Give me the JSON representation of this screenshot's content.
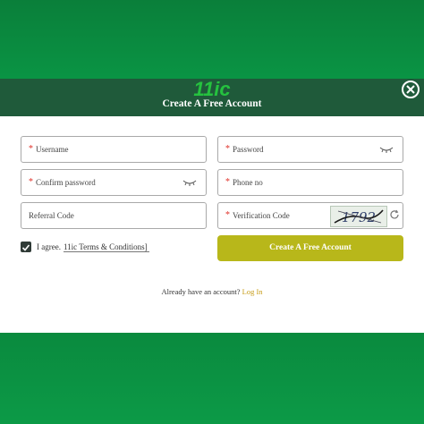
{
  "modal": {
    "logo_text": "11ic",
    "title": "Create A Free Account"
  },
  "form": {
    "username_label": "Username",
    "password_label": "Password",
    "confirm_password_label": "Confirm password",
    "phone_label": "Phone no",
    "referral_label": "Referral Code",
    "verification_label": "Verification Code",
    "captcha_text": "1792",
    "required_mark": "*",
    "agree_prefix": "I agree.",
    "terms_link": "11ic Terms & Conditions]",
    "submit_label": "Create A Free Account"
  },
  "footer": {
    "login_prompt": "Already have an account?",
    "login_link": "Log In"
  },
  "colors": {
    "brand_green": "#0a8a3e",
    "header_bg": "#1f5a3a",
    "button": "#b8b71a",
    "required": "#e0322a",
    "link": "#c79d1a"
  }
}
